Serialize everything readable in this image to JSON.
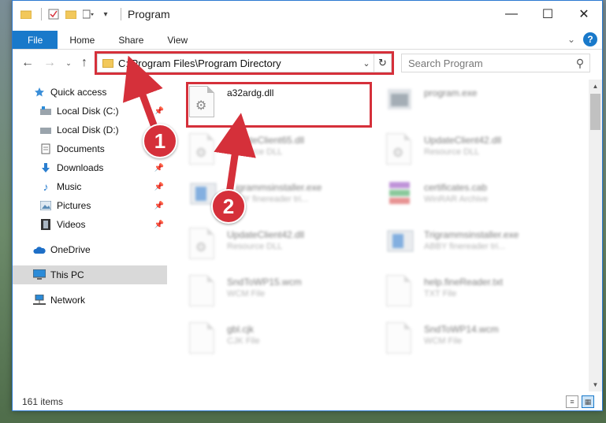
{
  "window": {
    "title": "Program"
  },
  "ribbon": {
    "tabs": [
      "File",
      "Home",
      "Share",
      "View"
    ],
    "help": "?"
  },
  "address": {
    "path": "C:\\Program Files\\Program Directory"
  },
  "search": {
    "placeholder": "Search Program"
  },
  "sidebar": {
    "items": [
      {
        "label": "Quick access",
        "icon": "star-icon",
        "pinned": false
      },
      {
        "label": "Local Disk (C:)",
        "icon": "drive-icon",
        "pinned": true
      },
      {
        "label": "Local Disk (D:)",
        "icon": "drive-icon",
        "pinned": false
      },
      {
        "label": "Documents",
        "icon": "document-icon",
        "pinned": true
      },
      {
        "label": "Downloads",
        "icon": "download-icon",
        "pinned": true
      },
      {
        "label": "Music",
        "icon": "music-icon",
        "pinned": true
      },
      {
        "label": "Pictures",
        "icon": "picture-icon",
        "pinned": true
      },
      {
        "label": "Videos",
        "icon": "video-icon",
        "pinned": true
      },
      {
        "label": "OneDrive",
        "icon": "cloud-icon",
        "pinned": false
      },
      {
        "label": "This PC",
        "icon": "computer-icon",
        "pinned": false,
        "selected": true
      },
      {
        "label": "Network",
        "icon": "network-icon",
        "pinned": false
      }
    ]
  },
  "files": [
    {
      "name": "a32ardg.dll",
      "type": "",
      "highlighted": true
    },
    {
      "name": "program.exe",
      "type": ""
    },
    {
      "name": "UpdateClient65.dll",
      "type": "Resource DLL"
    },
    {
      "name": "UpdateClient42.dll",
      "type": "Resource DLL"
    },
    {
      "name": "Trigrammsinstaller.exe",
      "type": "ABBY finereader tri..."
    },
    {
      "name": "certificates.cab",
      "type": "WinRAR Archive"
    },
    {
      "name": "UpdateClient42.dll",
      "type": "Resource DLL"
    },
    {
      "name": "Trigrammsinstaller.exe",
      "type": "ABBY finereader tri..."
    },
    {
      "name": "SndToWP15.wcm",
      "type": "WCM File"
    },
    {
      "name": "help.fineReader.txt",
      "type": "TXT File"
    },
    {
      "name": "gbl.cjk",
      "type": "CJK File"
    },
    {
      "name": "SndToWP14.wcm",
      "type": "WCM File"
    }
  ],
  "status": {
    "item_count": "161 items"
  },
  "annotations": {
    "step1": "1",
    "step2": "2",
    "color": "#d5303a"
  }
}
